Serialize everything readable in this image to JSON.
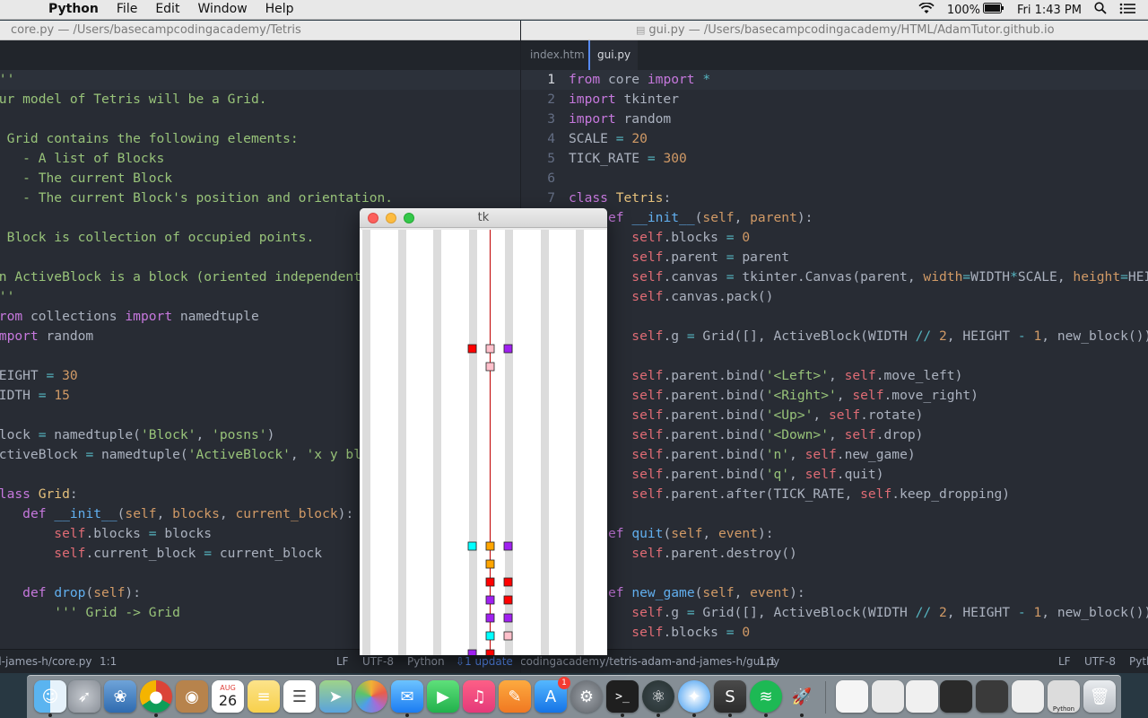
{
  "menubar": {
    "app": "Python",
    "items": [
      "File",
      "Edit",
      "Window",
      "Help"
    ],
    "battery": "100%",
    "clock": "Fri 1:43 PM"
  },
  "left_editor": {
    "title": "core.py — /Users/basecampcodingacademy/Tetris",
    "status": {
      "path": "d-james-h/core.py",
      "cursor": "1:1",
      "eol": "LF",
      "encoding": "UTF-8",
      "grammar": "Python",
      "update": "1 update"
    }
  },
  "right_editor": {
    "title": "gui.py — /Users/basecampcodingacademy/HTML/AdamTutor.github.io",
    "tabs": [
      "index.htm",
      "gui.py"
    ],
    "status": {
      "path": "codingacademy/tetris-adam-and-james-h/gui.py",
      "cursor": "1:1",
      "eol": "LF",
      "encoding": "UTF-8",
      "grammar": "Pyth"
    },
    "line_numbers": [
      "1",
      "2",
      "3",
      "4",
      "5",
      "6",
      "7"
    ]
  },
  "tk_window": {
    "title": "tk"
  },
  "dock": {
    "calendar_month": "AUG",
    "calendar_day": "26",
    "appstore_badge": "1",
    "python_label": "Python"
  },
  "colors": {
    "editor_bg": "#282c34",
    "keyword": "#c678dd",
    "string": "#98c379",
    "number": "#d19a66",
    "class": "#e5c07b",
    "self": "#e06c75",
    "function": "#61afef",
    "block_red": "#ff0000",
    "block_orange": "#ffa500",
    "block_purple": "#a020f0",
    "block_cyan": "#00ffff",
    "block_pink": "#ffc0cb"
  }
}
